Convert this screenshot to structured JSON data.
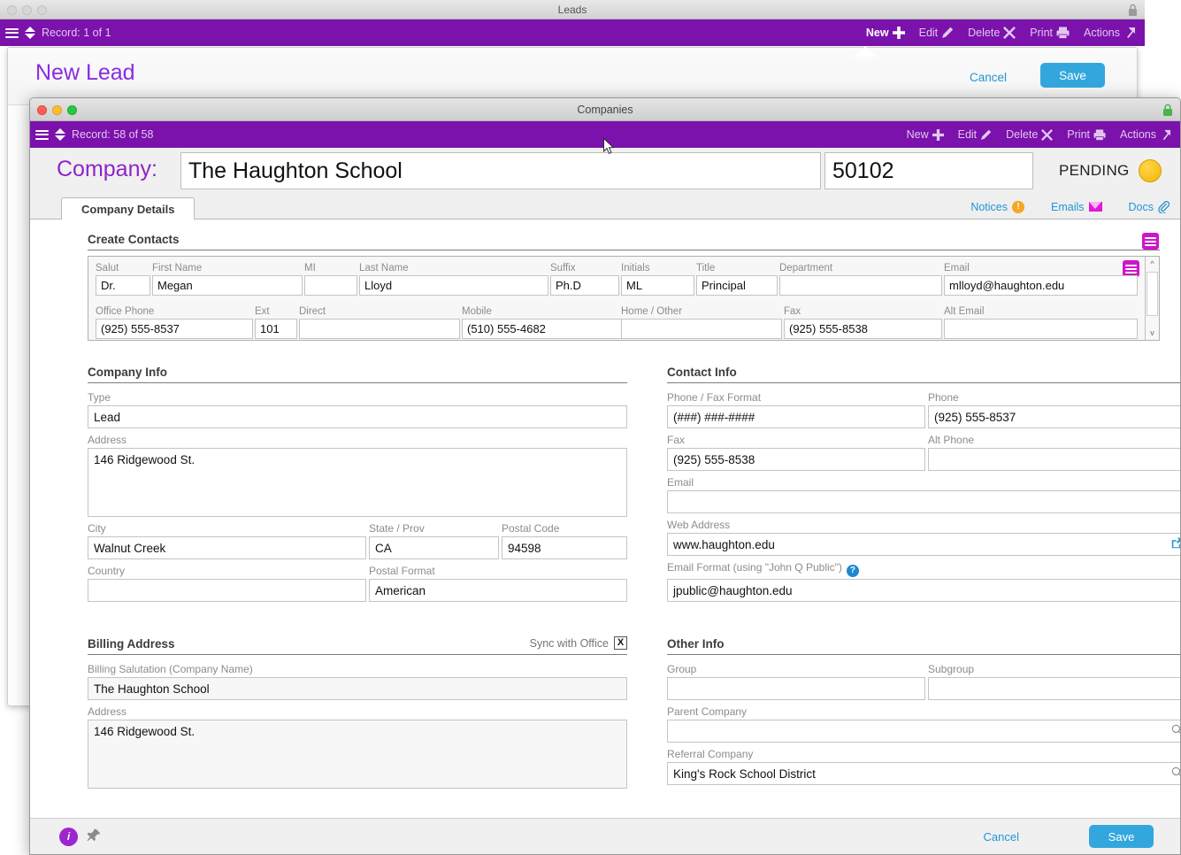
{
  "leads_window": {
    "title": "Leads",
    "toolbar": {
      "record_label": "Record: 1 of 1",
      "actions": [
        {
          "label": "New",
          "icon": "plus-icon",
          "active": true
        },
        {
          "label": "Edit",
          "icon": "pencil-icon",
          "active": false
        },
        {
          "label": "Delete",
          "icon": "x-icon",
          "active": false
        },
        {
          "label": "Print",
          "icon": "printer-icon",
          "active": false
        },
        {
          "label": "Actions",
          "icon": "arrow-out-icon",
          "active": false
        }
      ]
    },
    "card": {
      "title": "New Lead",
      "cancel_label": "Cancel",
      "save_label": "Save"
    }
  },
  "companies_window": {
    "title": "Companies",
    "toolbar": {
      "record_label": "Record: 58 of 58",
      "actions": [
        {
          "label": "New",
          "icon": "plus-icon"
        },
        {
          "label": "Edit",
          "icon": "pencil-icon"
        },
        {
          "label": "Delete",
          "icon": "x-icon"
        },
        {
          "label": "Print",
          "icon": "printer-icon"
        },
        {
          "label": "Actions",
          "icon": "arrow-out-icon"
        }
      ]
    },
    "header": {
      "company_label": "Company:",
      "company_name": "The Haughton School",
      "company_code": "50102",
      "status_text": "PENDING"
    },
    "tabs": [
      {
        "label": "Company Details",
        "selected": true
      }
    ],
    "tab_links": [
      {
        "label": "Notices",
        "icon": "alert-badge-icon"
      },
      {
        "label": "Emails",
        "icon": "envelope-icon"
      },
      {
        "label": "Docs",
        "icon": "paperclip-icon"
      }
    ],
    "create_contacts": {
      "title": "Create Contacts",
      "row1": [
        {
          "label": "Salut",
          "value": "Dr."
        },
        {
          "label": "First Name",
          "value": "Megan"
        },
        {
          "label": "MI",
          "value": ""
        },
        {
          "label": "Last Name",
          "value": "Lloyd"
        },
        {
          "label": "Suffix",
          "value": "Ph.D"
        },
        {
          "label": "Initials",
          "value": "ML"
        },
        {
          "label": "Title",
          "value": "Principal"
        },
        {
          "label": "Department",
          "value": ""
        },
        {
          "label": "Email",
          "value": "mlloyd@haughton.edu"
        }
      ],
      "row2": [
        {
          "label": "Office Phone",
          "value": "(925) 555-8537"
        },
        {
          "label": "Ext",
          "value": "101"
        },
        {
          "label": "Direct",
          "value": ""
        },
        {
          "label": "Mobile",
          "value": "(510) 555-4682"
        },
        {
          "label": "Home / Other",
          "value": ""
        },
        {
          "label": "Fax",
          "value": "(925) 555-8538"
        },
        {
          "label": "Alt Email",
          "value": ""
        }
      ]
    },
    "company_info": {
      "title": "Company Info",
      "type": {
        "label": "Type",
        "value": "Lead"
      },
      "address": {
        "label": "Address",
        "value": "146 Ridgewood St."
      },
      "city": {
        "label": "City",
        "value": "Walnut Creek"
      },
      "state": {
        "label": "State / Prov",
        "value": "CA"
      },
      "postal_code": {
        "label": "Postal Code",
        "value": "94598"
      },
      "country": {
        "label": "Country",
        "value": ""
      },
      "postal_format": {
        "label": "Postal Format",
        "value": "American"
      }
    },
    "contact_info": {
      "title": "Contact Info",
      "phone_fax_format": {
        "label": "Phone / Fax Format",
        "value": "(###) ###-####"
      },
      "phone": {
        "label": "Phone",
        "value": "(925) 555-8537"
      },
      "fax": {
        "label": "Fax",
        "value": "(925) 555-8538"
      },
      "alt_phone": {
        "label": "Alt Phone",
        "value": ""
      },
      "email": {
        "label": "Email",
        "value": ""
      },
      "web_address": {
        "label": "Web Address",
        "value": "www.haughton.edu"
      },
      "email_format": {
        "label": "Email Format (using \"John Q Public\")",
        "value": "jpublic@haughton.edu"
      }
    },
    "billing_address": {
      "title": "Billing Address",
      "sync_label": "Sync with Office",
      "sync_checked": "X",
      "salutation": {
        "label": "Billing Salutation (Company Name)",
        "value": "The Haughton School"
      },
      "address": {
        "label": "Address",
        "value": "146 Ridgewood St."
      }
    },
    "other_info": {
      "title": "Other Info",
      "group": {
        "label": "Group",
        "value": ""
      },
      "subgroup": {
        "label": "Subgroup",
        "value": ""
      },
      "parent_company": {
        "label": "Parent Company",
        "value": ""
      },
      "referral_company": {
        "label": "Referral Company",
        "value": "King's Rock School District"
      }
    },
    "footer": {
      "cancel_label": "Cancel",
      "save_label": "Save"
    }
  },
  "colors": {
    "purple_toolbar": "#7a12ab",
    "accent_blue": "#33a7dd",
    "company_label_purple": "#8e24c9",
    "magenta": "#cc17c9",
    "status_amber": "#f2b705"
  }
}
